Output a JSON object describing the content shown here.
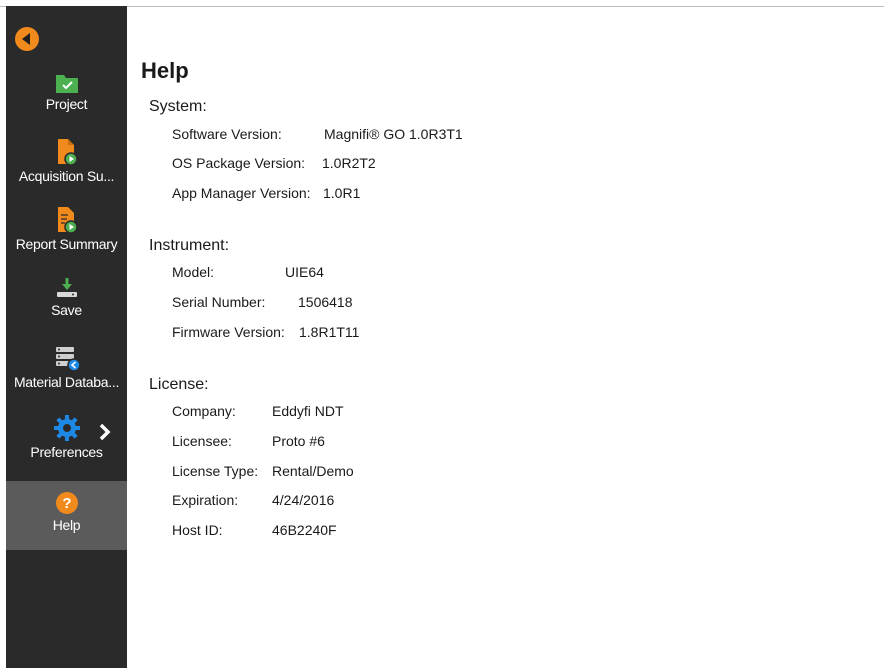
{
  "sidebar": {
    "items": [
      {
        "label": "Project",
        "icon": "folder-check-icon"
      },
      {
        "label": "Acquisition Su...",
        "icon": "document-play-icon"
      },
      {
        "label": "Report Summary",
        "icon": "report-play-icon"
      },
      {
        "label": "Save",
        "icon": "download-drive-icon"
      },
      {
        "label": "Material Databa...",
        "icon": "database-icon"
      },
      {
        "label": "Preferences",
        "icon": "gear-icon"
      },
      {
        "label": "Help",
        "icon": "help-icon"
      }
    ],
    "active": "Help"
  },
  "colors": {
    "sidebar_bg": "#2a2a2a",
    "active_bg": "#5b5b5b",
    "accent_orange": "#f08a1c",
    "accent_green": "#4caf50"
  },
  "main": {
    "title": "Help",
    "system": {
      "heading": "System:",
      "rows": [
        {
          "label": "Software Version:",
          "value": "Magnifi® GO 1.0R3T1"
        },
        {
          "label": "OS Package Version:",
          "value": "1.0R2T2"
        },
        {
          "label": "App Manager Version:",
          "value": "1.0R1"
        }
      ]
    },
    "instrument": {
      "heading": "Instrument:",
      "rows": [
        {
          "label": "Model:",
          "value": "UIE64"
        },
        {
          "label": "Serial Number:",
          "value": "1506418"
        },
        {
          "label": "Firmware Version:",
          "value": "1.8R1T11"
        }
      ]
    },
    "license": {
      "heading": "License:",
      "rows": [
        {
          "label": "Company:",
          "value": "Eddyfi NDT"
        },
        {
          "label": "Licensee:",
          "value": "Proto #6"
        },
        {
          "label": "License Type:",
          "value": "Rental/Demo"
        },
        {
          "label": "Expiration:",
          "value": "4/24/2016"
        },
        {
          "label": "Host ID:",
          "value": "46B2240F"
        }
      ]
    }
  }
}
